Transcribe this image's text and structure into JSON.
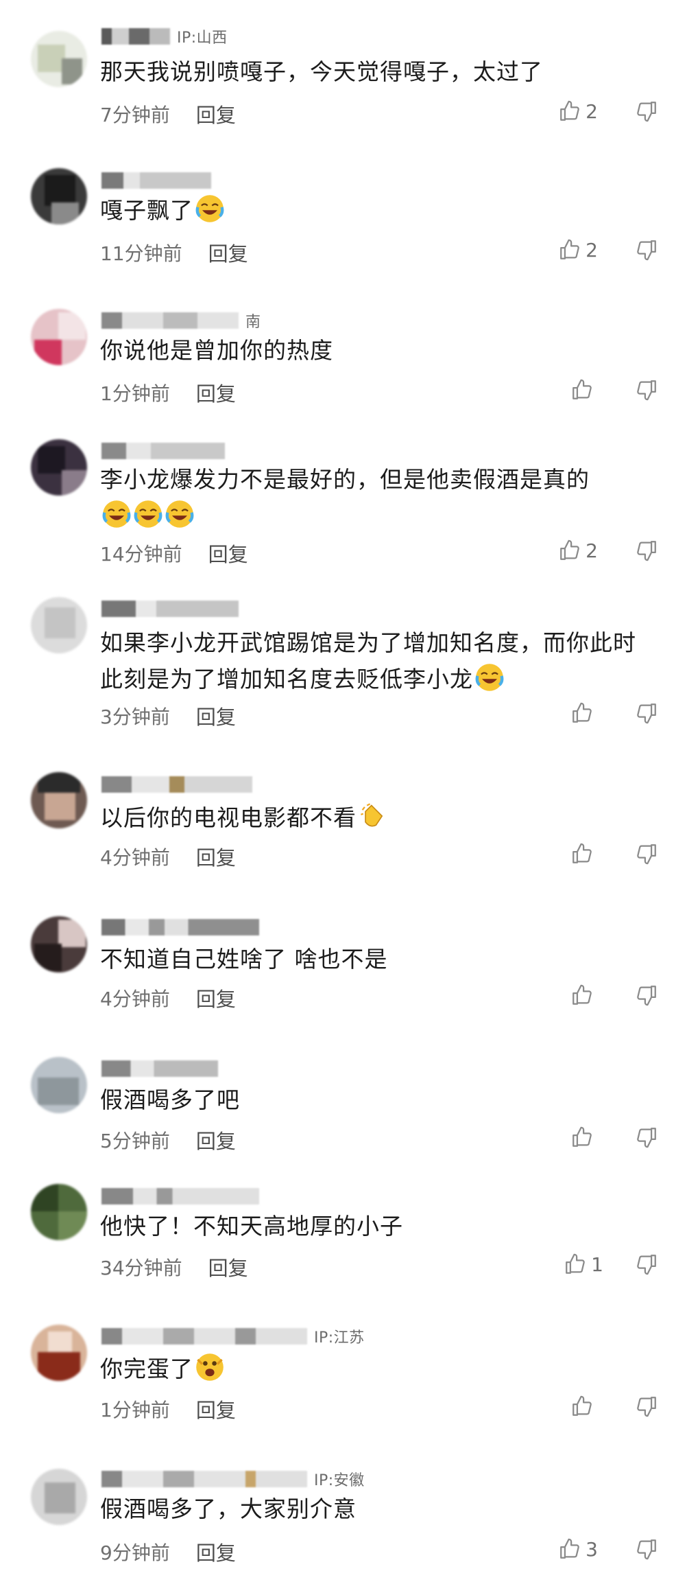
{
  "comments": [
    {
      "ip": "IP:山西",
      "text": "那天我说别喷嘎子，今天觉得嘎子，太过了",
      "emoji_count": 0,
      "emoji": "",
      "time": "7分钟前",
      "reply": "回复",
      "likes": "2"
    },
    {
      "ip": "",
      "text": "嘎子飘了",
      "emoji_count": 1,
      "emoji": "laughing-crying-emoji",
      "time": "11分钟前",
      "reply": "回复",
      "likes": "2"
    },
    {
      "ip": "",
      "name_frag": "南",
      "text": "你说他是曾加你的热度",
      "emoji_count": 0,
      "emoji": "",
      "time": "1分钟前",
      "reply": "回复",
      "likes": ""
    },
    {
      "ip": "",
      "text": "李小龙爆发力不是最好的，但是他卖假酒是真的",
      "emoji_count": 3,
      "emoji": "laughing-crying-emoji",
      "time": "14分钟前",
      "reply": "回复",
      "likes": "2"
    },
    {
      "ip": "",
      "text": "如果李小龙开武馆踢馆是为了增加知名度，而你此时此刻是为了增加知名度去贬低李小龙",
      "emoji_count": 1,
      "emoji": "laughing-crying-emoji",
      "time": "3分钟前",
      "reply": "回复",
      "likes": ""
    },
    {
      "ip": "",
      "text": "以后你的电视电影都不看",
      "emoji_count": 1,
      "emoji": "clapping-hands-emoji",
      "time": "4分钟前",
      "reply": "回复",
      "likes": ""
    },
    {
      "ip": "",
      "text": "不知道自己姓啥了  啥也不是",
      "emoji_count": 0,
      "emoji": "",
      "time": "4分钟前",
      "reply": "回复",
      "likes": ""
    },
    {
      "ip": "",
      "text": "假酒喝多了吧",
      "emoji_count": 0,
      "emoji": "",
      "time": "5分钟前",
      "reply": "回复",
      "likes": ""
    },
    {
      "ip": "",
      "text": "他快了！不知天高地厚的小子",
      "emoji_count": 0,
      "emoji": "",
      "time": "34分钟前",
      "reply": "回复",
      "likes": "1"
    },
    {
      "ip": "IP:江苏",
      "text": "你完蛋了",
      "emoji_count": 1,
      "emoji": "scared-emoji",
      "time": "1分钟前",
      "reply": "回复",
      "likes": ""
    },
    {
      "ip": "IP:安徽",
      "text": "假酒喝多了，大家别介意",
      "emoji_count": 0,
      "emoji": "",
      "time": "9分钟前",
      "reply": "回复",
      "likes": "3"
    }
  ]
}
